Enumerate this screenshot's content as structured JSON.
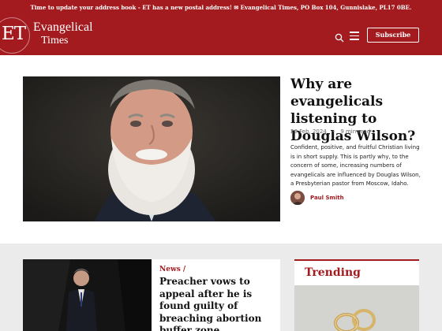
{
  "announcement": "Time to update your address book - ET has a new postal address! ✉ Evangelical Times, PO Box 104, Gunnislake, PL17 0BE.",
  "header": {
    "logo_initials": "ET",
    "logo_line1": "Evangelical",
    "logo_line2": "Times",
    "subscribe_label": "Subscribe",
    "brand_color": "#a31b1f"
  },
  "hero": {
    "title": "Why are evangelicals listening to Douglas Wilson?",
    "date": "26 Feb, 2024",
    "separator": "•",
    "read_time": "9 min read",
    "excerpt": "Confident, positive, and fruitful Christian living is in short supply. This is partly why, to the concern of some, increasing numbers of evangelicals are influenced by Douglas Wilson, a Presbyterian pastor from Moscow, Idaho.",
    "author": "Paul Smith"
  },
  "news": {
    "category": "News /",
    "title": "Preacher vows to appeal after he is found guilty of breaching abortion buffer zone"
  },
  "trending": {
    "title": "Trending"
  }
}
